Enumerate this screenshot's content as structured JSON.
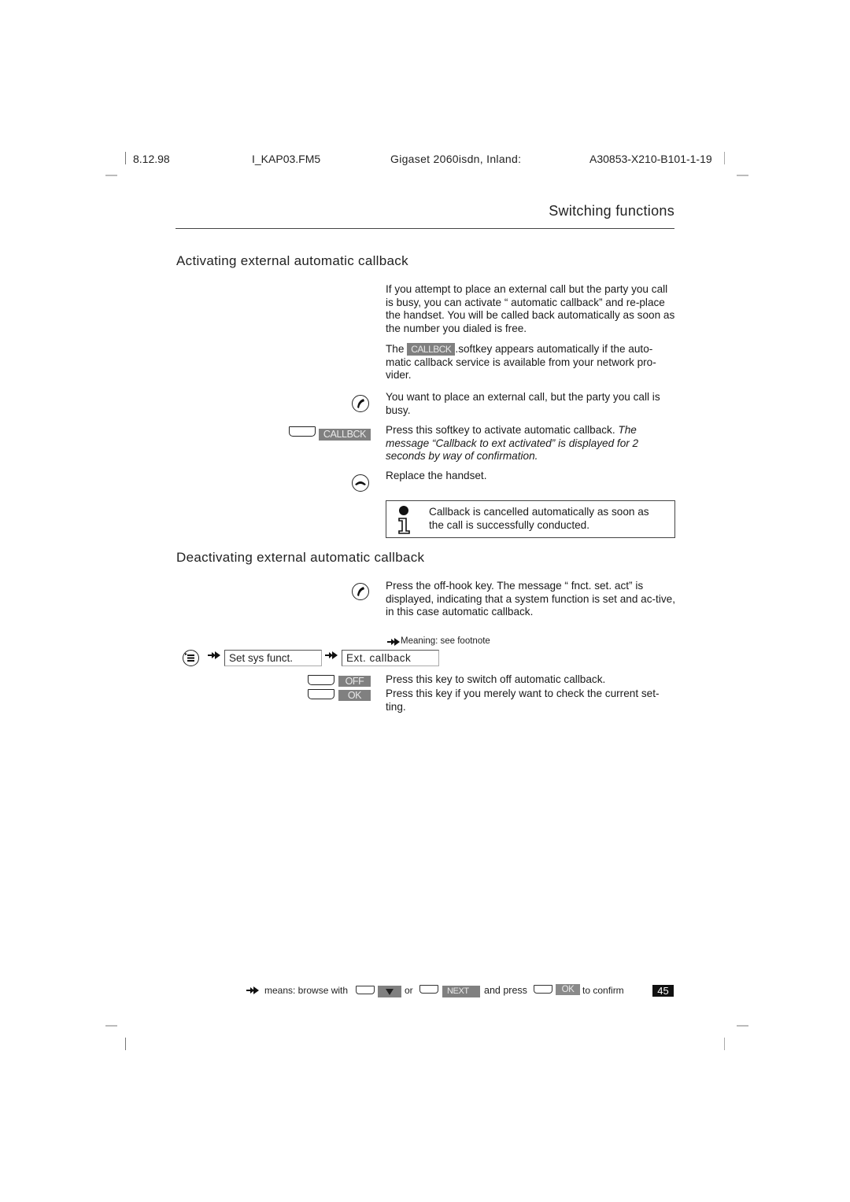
{
  "header": {
    "date": "8.12.98",
    "file": "I_KAP03.FM5",
    "product": "Gigaset 2060isdn, Inland:",
    "doc_number": "A30853-X210-B101-1-19"
  },
  "chapter_title": "Switching functions",
  "section_activate": {
    "title": "Activating external automatic callback",
    "intro": "If you attempt to place an external call but the party you call is busy, you can activate “ automatic callback”  and re-place the handset. You will be called back automatically as soon as the number you dialed is free.",
    "softkey_note_prefix": "The",
    "softkey_label": "CALLBCK",
    "softkey_note_suffix": ".softkey appears automatically if the auto-matic callback service is available from your network pro-vider.",
    "steps": [
      {
        "icon": "off-hook-icon",
        "text": "You want to place an external call, but the party you call is busy."
      },
      {
        "icon": "softkey",
        "key_label": "CALLBCK",
        "text": "Press this softkey to activate automatic callback.",
        "italic_text": "The message “Callback to ext activated”  is displayed for 2 seconds by way of confirmation."
      },
      {
        "icon": "on-hook-icon",
        "text": "Replace the handset."
      }
    ],
    "note": "Callback is cancelled automatically as soon as the call is successfully conducted."
  },
  "section_deactivate": {
    "title": "Deactivating external automatic callback",
    "step_offhook": "Press the off-hook key. The message “ fnct. set. act”  is displayed, indicating that a system function is set and ac-tive, in this case automatic callback.",
    "footnote_ref": "Meaning: see footnote",
    "menu_path": [
      "Set sys funct.",
      "Ext. callback"
    ],
    "keys": [
      {
        "label": "OFF",
        "text": "Press this key to switch off automatic callback."
      },
      {
        "label": "OK",
        "text": "Press this key if you merely want to check the current set-ting."
      }
    ]
  },
  "footer": {
    "means_browse": "means: browse with",
    "or": "or",
    "next_label": "NEXT",
    "and_press": "and press",
    "ok_label": "OK",
    "to_confirm": "to confirm",
    "page_number": "45"
  }
}
